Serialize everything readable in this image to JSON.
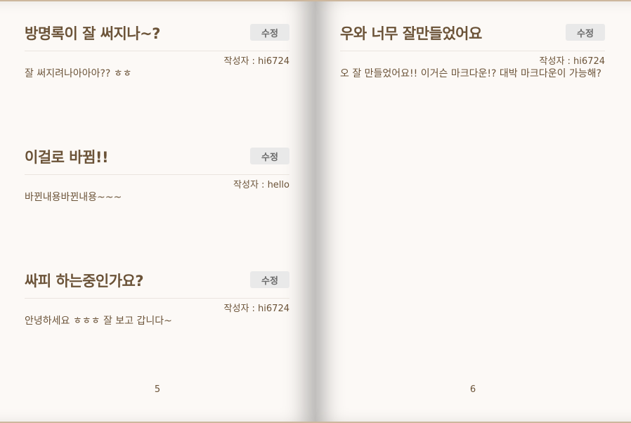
{
  "left_page": {
    "number": "5",
    "entries": [
      {
        "title": "방명록이 잘 써지나~?",
        "edit_label": "수정",
        "author": "작성자 : hi6724",
        "content": "잘 써지려나아아아?? ㅎㅎ"
      },
      {
        "title": "이걸로 바뀜!!",
        "edit_label": "수정",
        "author": "작성자 : hello",
        "content": "바뀐내용바뀐내용~~~"
      },
      {
        "title": "싸피 하는중인가요?",
        "edit_label": "수정",
        "author": "작성자 : hi6724",
        "content": "안녕하세요 ㅎㅎㅎ 잘 보고 갑니다~"
      }
    ]
  },
  "right_page": {
    "number": "6",
    "entries": [
      {
        "title": "우와 너무 잘만들었어요",
        "edit_label": "수정",
        "author": "작성자 : hi6724",
        "content": "오 잘 만들었어요!! 이거슨 마크다운!? 대박 마크다운이 가능해?"
      }
    ]
  },
  "colors": {
    "page_bg": "#fcf9f6",
    "text_brown": "#6b5338",
    "button_bg": "#e9e9e9"
  }
}
